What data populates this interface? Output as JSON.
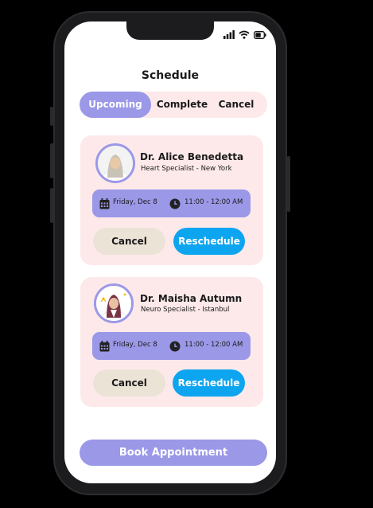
{
  "screen": {
    "title": "Schedule"
  },
  "tabs": [
    {
      "label": "Upcoming",
      "active": true
    },
    {
      "label": "Complete",
      "active": false
    },
    {
      "label": "Cancel",
      "active": false
    }
  ],
  "appointments": [
    {
      "doctor_name": "Dr. Alice Benedetta",
      "specialty": "Heart Specialist - New York",
      "date": "Friday, Dec 8",
      "time": "11:00 - 12:00 AM",
      "cancel_label": "Cancel",
      "reschedule_label": "Reschedule"
    },
    {
      "doctor_name": "Dr. Maisha Autumn",
      "specialty": "Neuro Specialist - Istanbul",
      "date": "Friday, Dec 8",
      "time": "11:00 - 12:00 AM",
      "cancel_label": "Cancel",
      "reschedule_label": "Reschedule"
    }
  ],
  "footer": {
    "book_label": "Book Appointment"
  },
  "icons": {
    "status": [
      "signal-icon",
      "wifi-icon",
      "battery-icon"
    ],
    "slot": [
      "calendar-icon",
      "clock-icon"
    ]
  },
  "colors": {
    "accent": "#9b98e8",
    "card_bg": "#fde9ea",
    "reschedule": "#0ea5f0",
    "cancel": "#ece3d7"
  }
}
